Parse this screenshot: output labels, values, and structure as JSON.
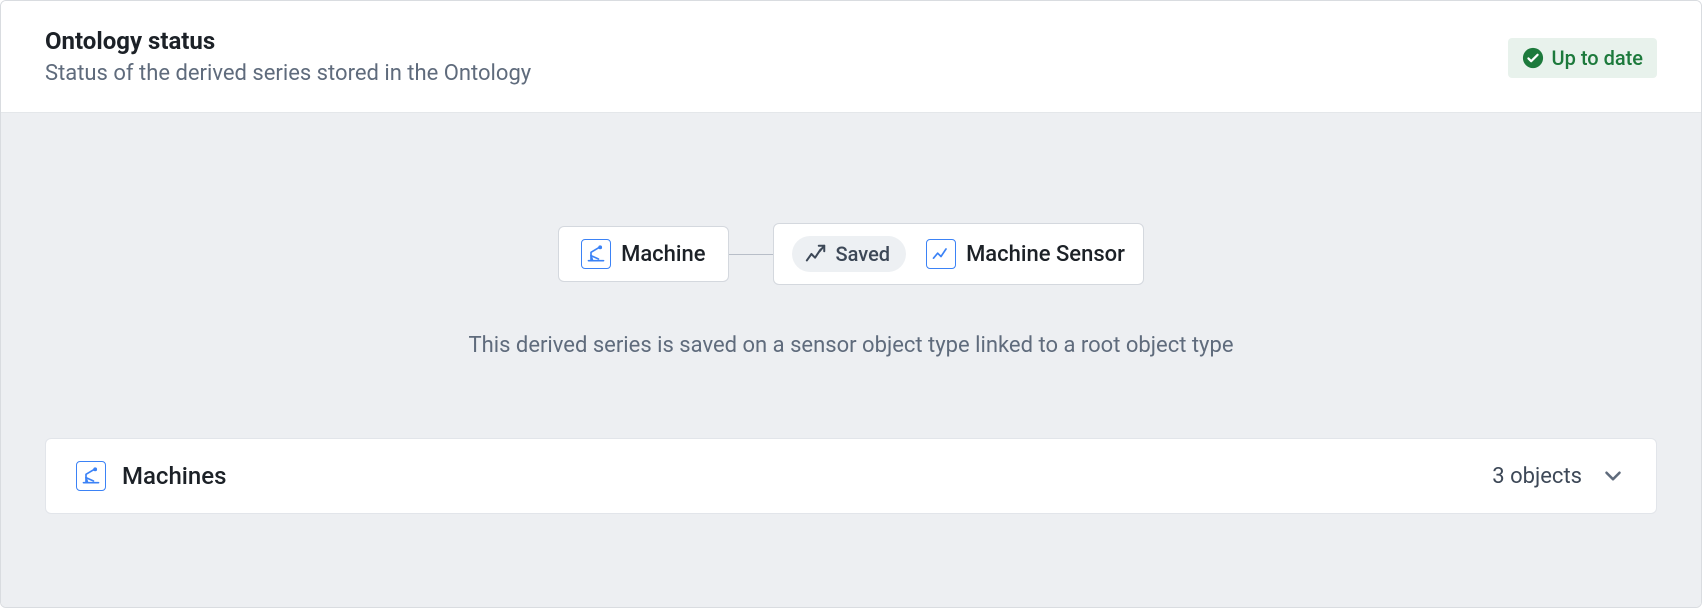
{
  "header": {
    "title": "Ontology status",
    "subtitle": "Status of the derived series stored in the Ontology",
    "status_label": "Up to date"
  },
  "diagram": {
    "root_node": {
      "label": "Machine",
      "icon": "pumpjack-icon"
    },
    "linked_node": {
      "state_label": "Saved",
      "state_icon": "chart-arrow-icon",
      "label": "Machine Sensor",
      "icon": "chart-line-icon"
    },
    "description": "This derived series is saved on a sensor object type linked to a root object type"
  },
  "list": {
    "group_label": "Machines",
    "group_icon": "pumpjack-icon",
    "count_label": "3 objects"
  },
  "colors": {
    "accent_blue": "#3b82f6",
    "success_green": "#1d7a3c",
    "body_bg": "#edeff2"
  }
}
